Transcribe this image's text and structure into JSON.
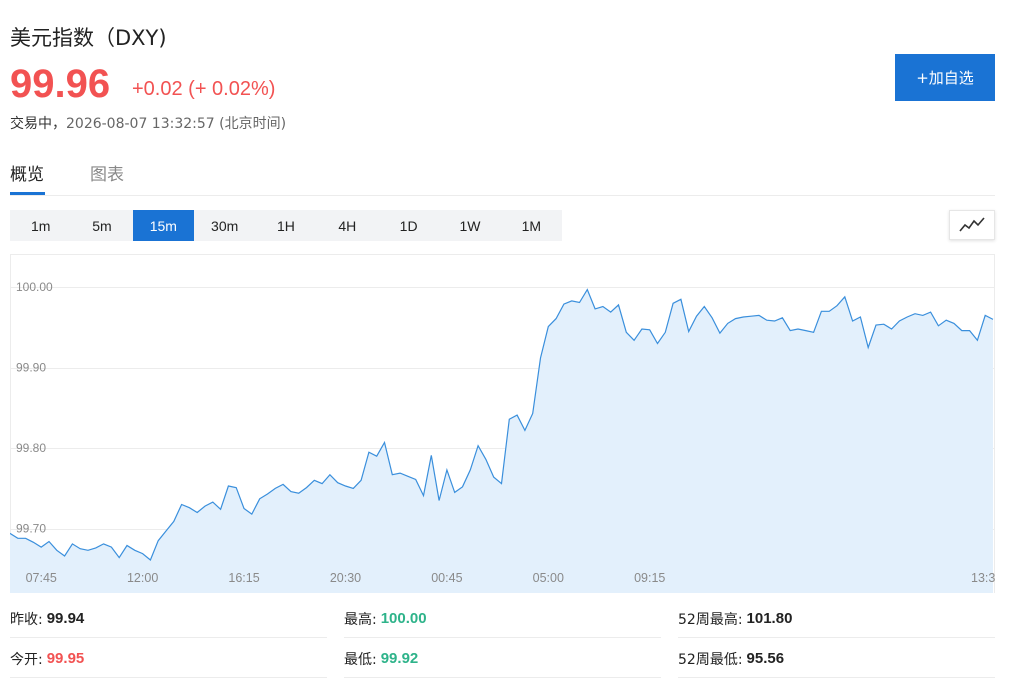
{
  "header": {
    "title": "美元指数（DXY)",
    "price": "99.96",
    "change": "+0.02 (+ 0.02%)",
    "status": "交易中，",
    "timestamp": "2026-08-07 13:32:57 (北京时间)",
    "add_button": "+加自选",
    "accent_color": "#1a73d4",
    "up_color": "#f25252",
    "down_color": "#2eb38a"
  },
  "tabs": [
    {
      "label": "概览",
      "active": true
    },
    {
      "label": "图表",
      "active": false
    }
  ],
  "periods": [
    {
      "label": "1m",
      "active": false
    },
    {
      "label": "5m",
      "active": false
    },
    {
      "label": "15m",
      "active": true
    },
    {
      "label": "30m",
      "active": false
    },
    {
      "label": "1H",
      "active": false
    },
    {
      "label": "4H",
      "active": false
    },
    {
      "label": "1D",
      "active": false
    },
    {
      "label": "1W",
      "active": false
    },
    {
      "label": "1M",
      "active": false
    }
  ],
  "chart_type_icon": "line-chart-icon",
  "chart_data": {
    "type": "area",
    "title": "",
    "xlabel": "",
    "ylabel": "",
    "ylim": [
      99.62,
      100.04
    ],
    "y_ticks": [
      {
        "value": 100.0,
        "label": "100.00"
      },
      {
        "value": 99.9,
        "label": "99.90"
      },
      {
        "value": 99.8,
        "label": "99.80"
      },
      {
        "value": 99.7,
        "label": "99.70"
      }
    ],
    "x_ticks": [
      {
        "index": 4,
        "label": "07:45"
      },
      {
        "index": 17,
        "label": "12:00"
      },
      {
        "index": 30,
        "label": "16:15"
      },
      {
        "index": 43,
        "label": "20:30"
      },
      {
        "index": 56,
        "label": "00:45"
      },
      {
        "index": 69,
        "label": "05:00"
      },
      {
        "index": 82,
        "label": "09:15"
      },
      {
        "index": 95,
        "label": "13:3"
      }
    ],
    "grid": true,
    "line_color": "#3a8fdc",
    "fill_color": "#e3f0fc",
    "series": [
      {
        "values": [
          99.694,
          99.688,
          99.688,
          99.683,
          99.677,
          99.684,
          99.673,
          99.666,
          99.681,
          99.675,
          99.673,
          99.676,
          99.681,
          99.677,
          99.664,
          99.679,
          99.673,
          99.669,
          99.661,
          99.685,
          99.697,
          99.709,
          99.73,
          99.726,
          99.72,
          99.728,
          99.733,
          99.724,
          99.753,
          99.751,
          99.725,
          99.718,
          99.737,
          99.743,
          99.75,
          99.755,
          99.746,
          99.744,
          99.751,
          99.76,
          99.756,
          99.767,
          99.757,
          99.753,
          99.75,
          99.76,
          99.795,
          99.79,
          99.807,
          99.767,
          99.769,
          99.765,
          99.761,
          99.741,
          99.791,
          99.735,
          99.773,
          99.745,
          99.752,
          99.773,
          99.803,
          99.786,
          99.764,
          99.756,
          99.836,
          99.841,
          99.822,
          99.843,
          99.912,
          99.951,
          99.961,
          99.979,
          99.983,
          99.981,
          99.997,
          99.973,
          99.976,
          99.969,
          99.978,
          99.944,
          99.934,
          99.948,
          99.947,
          99.93,
          99.944,
          99.98,
          99.985,
          99.945,
          99.964,
          99.976,
          99.962,
          99.943,
          99.955,
          99.961,
          99.963,
          99.964,
          99.965,
          99.959,
          99.958,
          99.962,
          99.946,
          99.948,
          99.946,
          99.944,
          99.97,
          99.97,
          99.977,
          99.988,
          99.958,
          99.963,
          99.925,
          99.953,
          99.954,
          99.948,
          99.958,
          99.963,
          99.967,
          99.965,
          99.969,
          99.952,
          99.959,
          99.955,
          99.946,
          99.946,
          99.934,
          99.965,
          99.96
        ]
      }
    ]
  },
  "stats": [
    {
      "label": "昨收:",
      "value": "99.94",
      "color": "#222222"
    },
    {
      "label": "最高:",
      "value": "100.00",
      "color": "#2eb38a"
    },
    {
      "label": "52周最高:",
      "value": "101.80",
      "color": "#222222"
    },
    {
      "label": "今开:",
      "value": "99.95",
      "color": "#f25252"
    },
    {
      "label": "最低:",
      "value": "99.92",
      "color": "#2eb38a"
    },
    {
      "label": "52周最低:",
      "value": "95.56",
      "color": "#222222"
    }
  ]
}
